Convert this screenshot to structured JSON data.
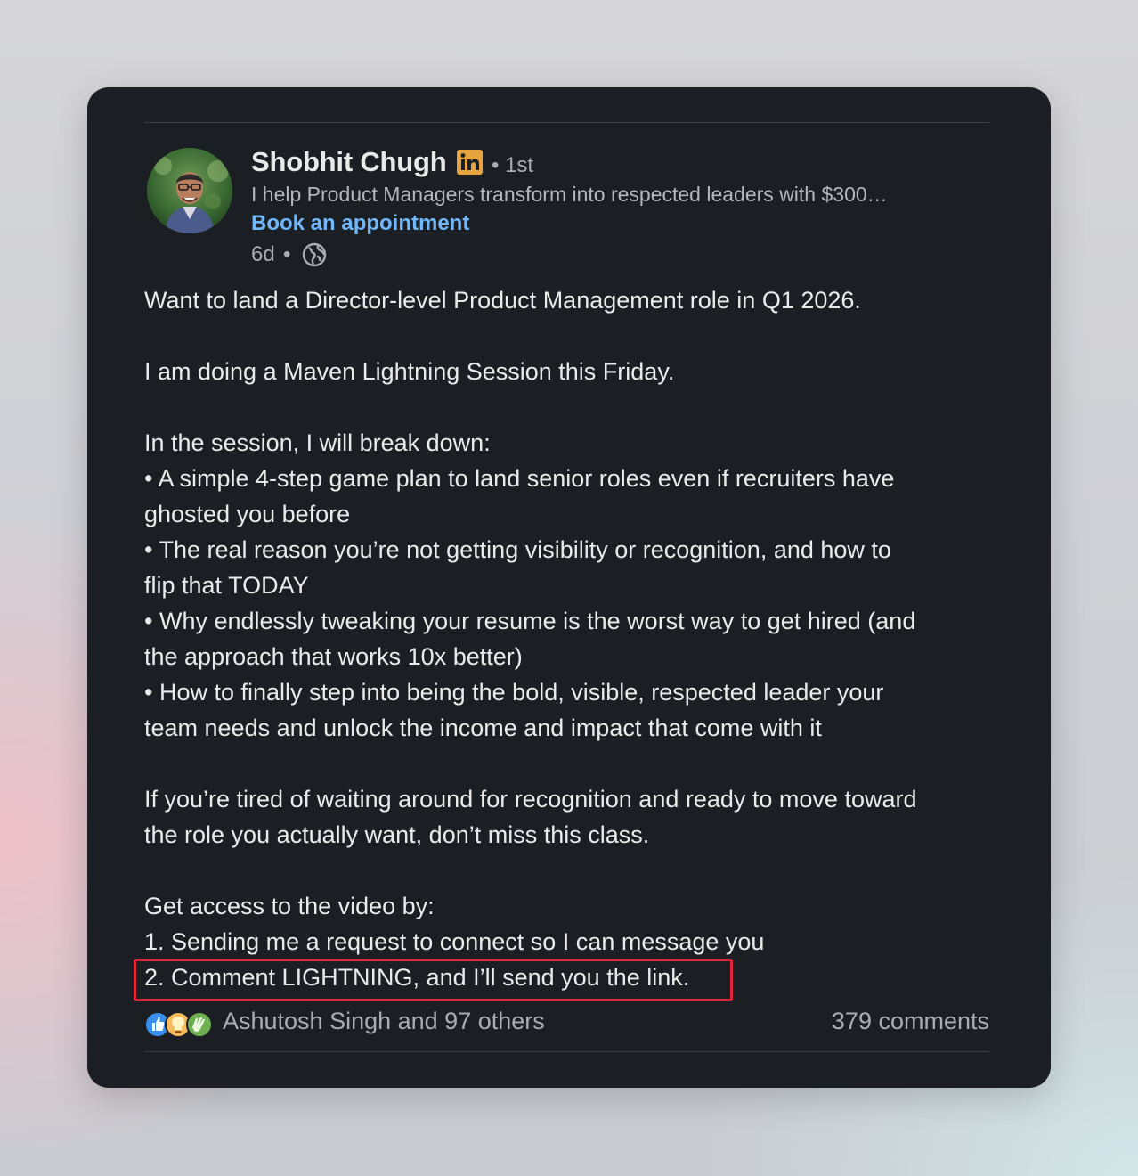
{
  "post": {
    "author": {
      "name": "Shobhit Chugh",
      "connection_degree": "1st",
      "headline": "I help Product Managers transform into respected leaders with $300…",
      "cta_link": "Book an appointment",
      "premium_badge_icon": "linkedin-in-icon",
      "avatar_icon": "profile-photo"
    },
    "meta": {
      "age": "6d",
      "separator": "•",
      "degree_separator": "•",
      "visibility_icon": "globe-icon"
    },
    "body_lines": [
      "Want to land a Director-level Product Management role in Q1 2026.",
      "",
      "I am doing a Maven Lightning Session this Friday.",
      "",
      "In the session, I will break down:",
      " • A simple 4-step game plan to land senior roles even if recruiters have",
      "ghosted you before",
      " • The real reason you’re not getting visibility or recognition, and how to",
      "flip that TODAY",
      " • Why endlessly tweaking your resume is the worst way to get hired (and",
      "the approach that works 10x better)",
      " • How to finally step into being the bold, visible, respected leader your",
      "team needs and unlock the income and impact that come with it",
      "",
      "If you’re tired of waiting around for recognition and ready to move toward",
      "the role you actually want, don’t miss this class.",
      "",
      "Get access to the video by:",
      "1. Sending me a request to connect so I can message you",
      "2. Comment LIGHTNING, and I’ll send you the link."
    ],
    "social": {
      "reactions_text": "Ashutosh Singh and 97 others",
      "comments_text": "379 comments",
      "reaction_icons": [
        "like-icon",
        "insightful-icon",
        "celebrate-icon"
      ]
    }
  },
  "colors": {
    "card_bg": "#1b1f23",
    "link_blue": "#71b7fb",
    "badge_orange": "#e7a33e",
    "highlight_red": "#e1253a",
    "text_primary": "#eaeaeb",
    "text_secondary": "#a9adb2"
  }
}
